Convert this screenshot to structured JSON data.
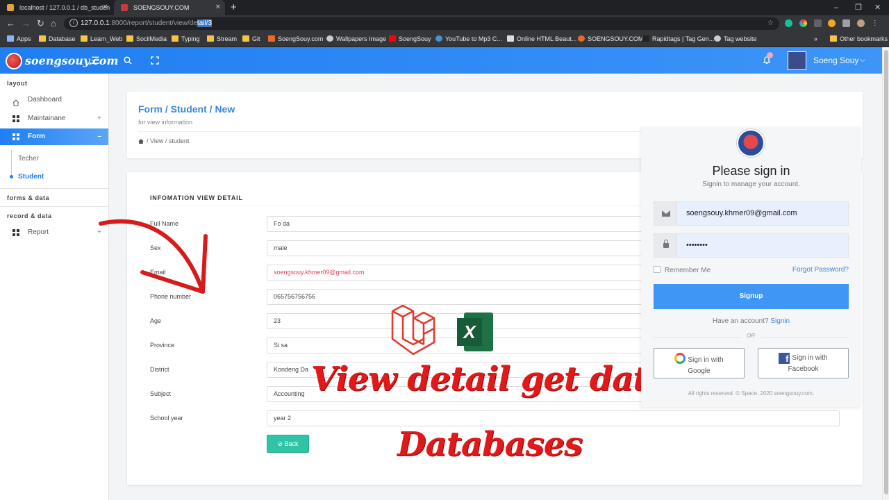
{
  "browser": {
    "tabs": [
      {
        "label": "localhost / 127.0.0.1 / db_studen",
        "active": false
      },
      {
        "label": "SOENGSOUY.COM",
        "active": true
      }
    ],
    "url_host": "127.0.0.1",
    "url_port_path": ":8000/report/student/view/de",
    "url_selected": "tail/3",
    "bookmarks": [
      "Apps",
      "Database",
      "Learn_Web",
      "SocilMedia",
      "Typing",
      "Stream",
      "Git",
      "SoengSouy.com",
      "Wallpapers Image",
      "SoengSouy",
      "YouTube to Mp3 C...",
      "Online HTML Beaut...",
      "SOENGSOUY.COM",
      "Rapidtags | Tag Gen...",
      "Tag website"
    ],
    "other_bookmarks": "Other bookmarks",
    "more": "»"
  },
  "header": {
    "brand": "soengsouy.com",
    "user_name": "Soeng Souy"
  },
  "sidebar": {
    "section_layout": "layout",
    "items": [
      {
        "label": "Dashboard"
      },
      {
        "label": "Maintainane"
      },
      {
        "label": "Form"
      }
    ],
    "sub_items": [
      {
        "label": "Techer"
      },
      {
        "label": "Student"
      }
    ],
    "section_forms": "forms & data",
    "section_record": "record & data",
    "report": "Report",
    "plus": "+",
    "minus": "–"
  },
  "page_header": {
    "title": "Form / Student / New",
    "subtitle": "for view information",
    "crumb": "/  View  /  student"
  },
  "detail": {
    "title": "INFOMATION VIEW DETAIL",
    "fields": [
      {
        "label": "Full Name",
        "value": "Fo da"
      },
      {
        "label": "Sex",
        "value": "male"
      },
      {
        "label": "Email",
        "value": "soengsouy.khmer09@gmail.com"
      },
      {
        "label": "Phone number",
        "value": "065756756756"
      },
      {
        "label": "Age",
        "value": "23"
      },
      {
        "label": "Province",
        "value": "Si sa"
      },
      {
        "label": "District",
        "value": "Kondeng Da"
      },
      {
        "label": "Subject",
        "value": "Accounting"
      },
      {
        "label": "School year",
        "value": "year 2"
      }
    ],
    "back_label": "⊘ Back"
  },
  "overlay": {
    "line1": "View detail get data from",
    "line2": "Databases"
  },
  "login": {
    "title": "Please sign in",
    "subtitle": "Signin to manage your account.",
    "email": "soengsouy.khmer09@gmail.com",
    "password_mask": "••••••••",
    "remember": "Remember Me",
    "forgot": "Forgot Password?",
    "signup": "Signup",
    "have_account": "Have an account?",
    "signin_link": "Signin",
    "or": "OR",
    "google_1": "Sign in with",
    "google_2": "Google",
    "facebook_1": "Sign in with",
    "facebook_2": "Facebook",
    "footer": "All rights reserved. © Space. 2020 soengsouy.com."
  }
}
